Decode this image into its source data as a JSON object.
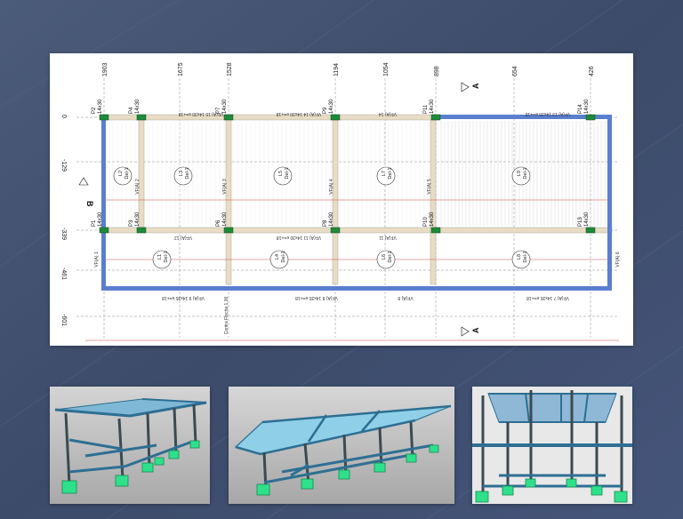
{
  "plan": {
    "x_axis_labels": [
      "1903",
      "1675",
      "1528",
      "1194",
      "1054",
      "898",
      "654",
      "426"
    ],
    "y_axis_labels": [
      "0",
      "-129",
      "-339",
      "-461",
      "-601"
    ],
    "pillars": [
      "P1",
      "P2",
      "P3",
      "P4",
      "P6",
      "P7",
      "P8",
      "P9",
      "P10",
      "P11",
      "P13",
      "P14"
    ],
    "pillar_section": "14x30",
    "slabs": [
      "L1",
      "L2",
      "L3",
      "L4",
      "L5",
      "L6",
      "L7",
      "L8",
      "L9"
    ],
    "slab_type": "Del-1",
    "section_marks": [
      "A",
      "A",
      "B"
    ],
    "beam_labels": [
      "VF(A) 15 14x30 e=+18",
      "VF(A) 14 14x30 e=+18",
      "VF(A) 14",
      "VF(A) 13 14x35 e=+18",
      "VF(A) 12",
      "VF(A) 11 14x30 e=+18",
      "VF(A) 11",
      "VF(A) 9 14x35 e=+18",
      "VF(A) 8 14x35 e=+18",
      "VF(A) 8",
      "VF(A) 7 14x35 e=+18",
      "VF(A) 1",
      "VF(A) 6",
      "VF(A) 2",
      "VF(A) 3",
      "VF(A) 4",
      "VF(A) 5",
      "Contra Flecha 1.00"
    ]
  },
  "colors": {
    "background": "#3f4f6e",
    "beam_blue": "#5b7fcf",
    "beam_tan": "#e9dcc4",
    "pillar_green": "#1f8a3a",
    "slab_line_red": "#d04848",
    "structure_cyan": "#3d7fa6",
    "footing_green": "#2fe08a"
  }
}
